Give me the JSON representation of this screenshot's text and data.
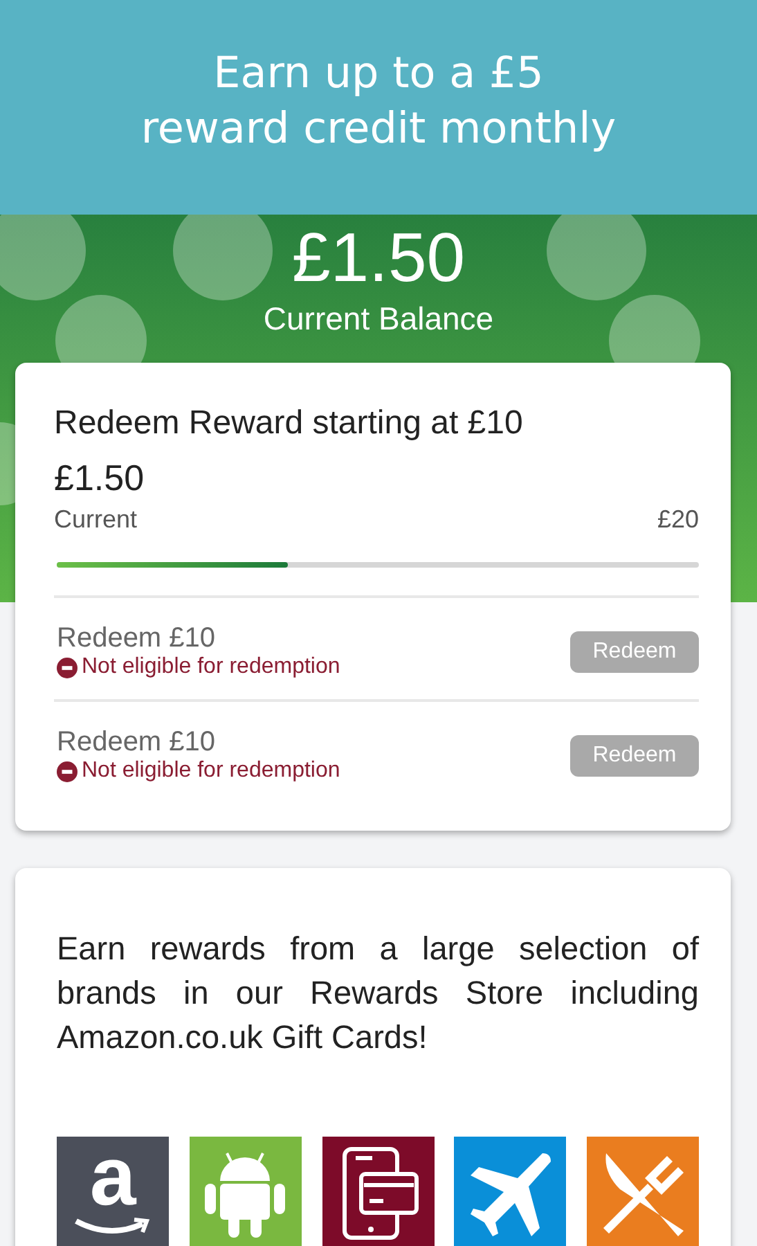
{
  "banner": {
    "title": "Earn up to a £5 reward credit monthly"
  },
  "balance": {
    "amount": "£1.50",
    "label": "Current Balance"
  },
  "reward_card": {
    "title": "Redeem Reward starting at £10",
    "amount": "£1.50",
    "current_label": "Current",
    "max_label": "£20",
    "level": 0.36,
    "options": [
      {
        "title": "Redeem £10",
        "status": "Not eligible for redemption",
        "button": "Redeem",
        "disabled": true
      },
      {
        "title": "Redeem £10",
        "status": "Not eligible for redemption",
        "button": "Redeem",
        "disabled": true
      }
    ]
  },
  "store_card": {
    "text": "Earn rewards from a large selection of brands in our Rewards Store including Amazon.co.uk Gift Cards!",
    "tiles": [
      {
        "kind": "amazon",
        "color": "#4b4f5a",
        "glyph": "a"
      },
      {
        "kind": "android",
        "color": "#7ab840"
      },
      {
        "kind": "cards",
        "color": "#7d0b29"
      },
      {
        "kind": "travel",
        "color": "#0a8fd8"
      },
      {
        "kind": "dining",
        "color": "#ea7d1f"
      }
    ]
  }
}
